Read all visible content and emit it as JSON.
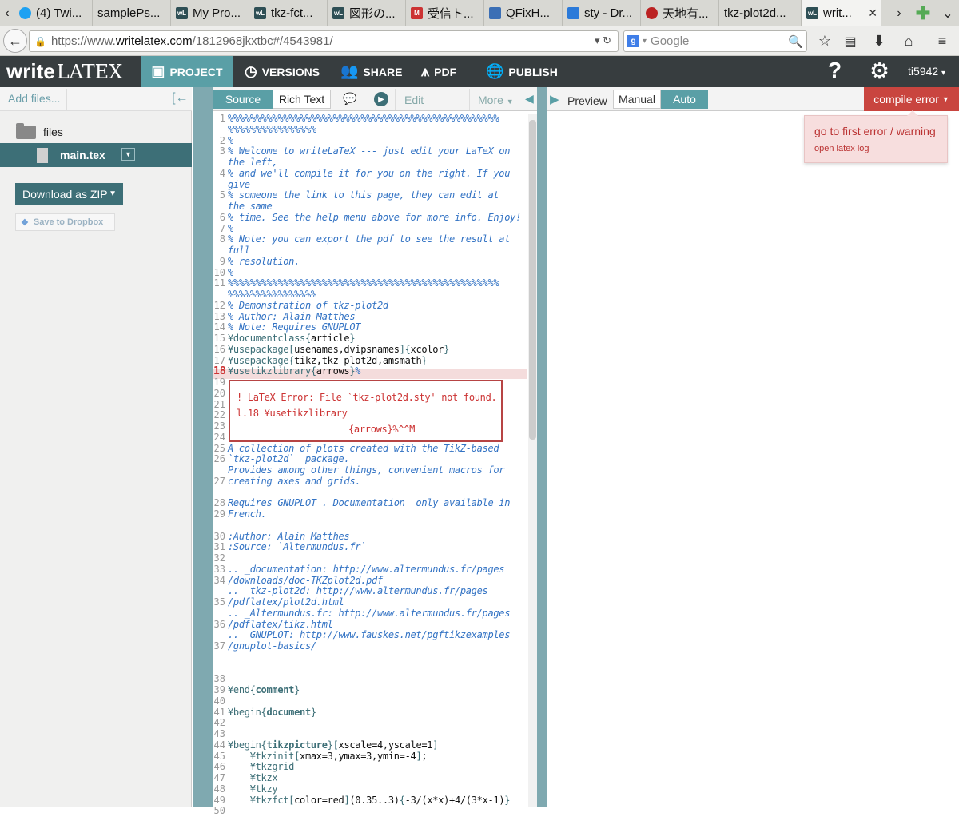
{
  "browser": {
    "tabs": [
      {
        "label": "(4) Twi...",
        "fav": "tw"
      },
      {
        "label": "samplePs...",
        "fav": ""
      },
      {
        "label": "My Pro...",
        "fav": "wl"
      },
      {
        "label": "tkz-fct...",
        "fav": "wl"
      },
      {
        "label": "図形の...",
        "fav": "wl"
      },
      {
        "label": "受信ト...",
        "fav": "gm"
      },
      {
        "label": "QFixH...",
        "fav": "qf"
      },
      {
        "label": "sty - Dr...",
        "fav": "db"
      },
      {
        "label": "天地有...",
        "fav": "tn"
      },
      {
        "label": "tkz-plot2d...",
        "fav": ""
      },
      {
        "label": "writ...",
        "fav": "wl",
        "active": true
      }
    ],
    "url_prefix": "https://www.",
    "url_host": "writelatex.com",
    "url_path": "/1812968jkxtbc#/4543981/",
    "search_placeholder": "Google"
  },
  "app": {
    "logo_write": "write",
    "logo_latex": "LATEX",
    "nav": {
      "project": "PROJECT",
      "versions": "VERSIONS",
      "share": "SHARE",
      "pdf": "PDF",
      "publish": "PUBLISH"
    },
    "user": "ti5942"
  },
  "sidebar": {
    "add_files": "Add files...",
    "folder": "files",
    "file": "main.tex",
    "download_zip": "Download as ZIP",
    "save_dropbox": "Save to Dropbox"
  },
  "editor": {
    "tab_source": "Source",
    "tab_rich": "Rich Text",
    "edit": "Edit",
    "more": "More",
    "error_line1": "! LaTeX Error: File `tkz-plot2d.sty' not found.",
    "error_line2": "l.18 ¥usetikzlibrary",
    "error_line3": "{arrows}%^^M"
  },
  "preview": {
    "label": "Preview",
    "manual": "Manual",
    "auto": "Auto",
    "compile_error": "compile error",
    "goto_error": "go to first error / warning",
    "open_log": "open latex log"
  },
  "colors": {
    "teal": "#5a9fa6",
    "dark_teal": "#3d6f77",
    "header": "#373d3f",
    "error_red": "#c9453f"
  }
}
